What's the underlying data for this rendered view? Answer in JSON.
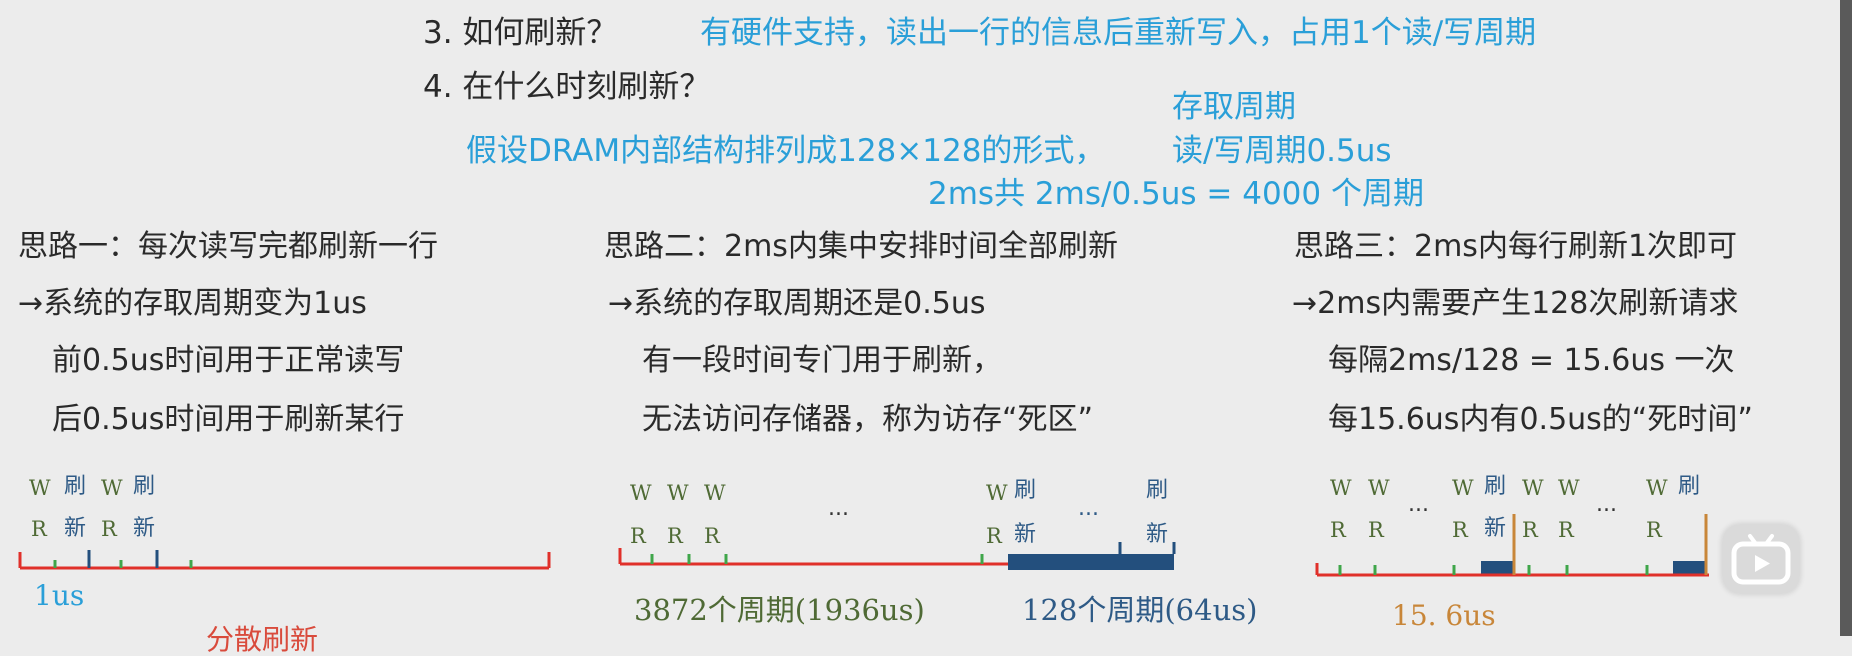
{
  "heading": {
    "q3_label": "3. 如何刷新？",
    "q3_answer": "有硬件支持，读出一行的信息后重新写入，占用1个读/写周期",
    "q4_label": "4. 在什么时刻刷新？",
    "assumption": "假设DRAM内部结构排列成128×128的形式，",
    "access_cycle_title": "存取周期",
    "rw_cycle": "读/写周期0.5us",
    "total_cycles": "2ms共 2ms/0.5us = 4000 个周期"
  },
  "approaches": [
    {
      "title": "思路一：每次读写完都刷新一行",
      "lines": [
        "→系统的存取周期变为1us",
        "前0.5us时间用于正常读写",
        "后0.5us时间用于刷新某行"
      ]
    },
    {
      "title": "思路二：2ms内集中安排时间全部刷新",
      "lines": [
        "→系统的存取周期还是0.5us",
        "有一段时间专门用于刷新，",
        "无法访问存储器，称为访存“死区”"
      ]
    },
    {
      "title": "思路三：2ms内每行刷新1次即可",
      "lines": [
        "→2ms内需要产生128次刷新请求",
        "每隔2ms/128 = 15.6us 一次",
        "每15.6us内有0.5us的“死时间”"
      ]
    }
  ],
  "timeline_labels": {
    "w": "W",
    "r": "R",
    "shua": "刷",
    "xin": "新",
    "ellipsis": "..."
  },
  "timeline1": {
    "caption": "1us"
  },
  "timeline2": {
    "caption_rw": "3872个周期(1936us)",
    "caption_refresh": "128个周期(64us)"
  },
  "timeline3": {
    "caption": "15. 6us"
  },
  "bottom_cut_text": "分散刷新",
  "colors": {
    "axis": "#e0302a",
    "tick_rw": "#3fa64a",
    "refresh_block": "#234f7d",
    "interval_mark": "#c88639"
  },
  "icons": {
    "video_player": "bilibili-tv-icon"
  }
}
